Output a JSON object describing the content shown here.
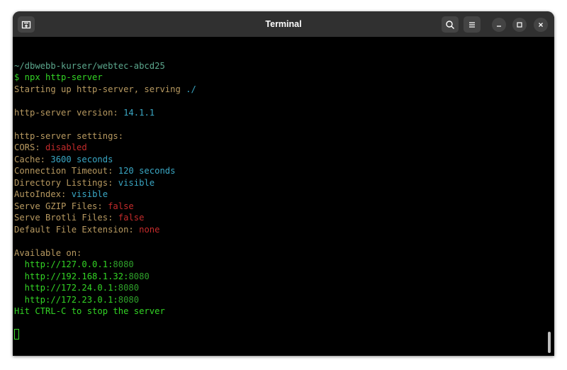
{
  "window": {
    "title": "Terminal"
  },
  "colors": {
    "background": "#000000",
    "titlebar": "#303030",
    "green": "#3bd42a",
    "bright_green": "#30c030",
    "yellowish": "#c0a060",
    "red": "#c42b2b",
    "cyan": "#3aa7c4",
    "dim_path": "#5aa88a"
  },
  "icons": {
    "new_tab": "new-tab-icon",
    "search": "search-icon",
    "menu": "hamburger-menu-icon",
    "minimize": "minimize-icon",
    "maximize": "maximize-icon",
    "close": "close-icon"
  },
  "terminal": {
    "lines": [
      [],
      [
        {
          "t": "~/dbwebb-kurser/webtec-abcd25",
          "c": "#5ca88e"
        }
      ],
      [
        {
          "t": "$ npx http-server",
          "c": "#33d425"
        }
      ],
      [
        {
          "t": "Starting up http-server, serving ",
          "c": "#b79960"
        },
        {
          "t": "./",
          "c": "#3aa7c4"
        }
      ],
      [],
      [
        {
          "t": "http-server version: ",
          "c": "#b79960"
        },
        {
          "t": "14.1.1",
          "c": "#3aa7c4"
        }
      ],
      [],
      [
        {
          "t": "http-server settings:",
          "c": "#b79960"
        }
      ],
      [
        {
          "t": "CORS: ",
          "c": "#b79960"
        },
        {
          "t": "disabled",
          "c": "#c42b2b"
        }
      ],
      [
        {
          "t": "Cache: ",
          "c": "#b79960"
        },
        {
          "t": "3600 seconds",
          "c": "#3aa7c4"
        }
      ],
      [
        {
          "t": "Connection Timeout: ",
          "c": "#b79960"
        },
        {
          "t": "120 seconds",
          "c": "#3aa7c4"
        }
      ],
      [
        {
          "t": "Directory Listings: ",
          "c": "#b79960"
        },
        {
          "t": "visible",
          "c": "#3aa7c4"
        }
      ],
      [
        {
          "t": "AutoIndex: ",
          "c": "#b79960"
        },
        {
          "t": "visible",
          "c": "#3aa7c4"
        }
      ],
      [
        {
          "t": "Serve GZIP Files: ",
          "c": "#b79960"
        },
        {
          "t": "false",
          "c": "#c42b2b"
        }
      ],
      [
        {
          "t": "Serve Brotli Files: ",
          "c": "#b79960"
        },
        {
          "t": "false",
          "c": "#c42b2b"
        }
      ],
      [
        {
          "t": "Default File Extension: ",
          "c": "#b79960"
        },
        {
          "t": "none",
          "c": "#c42b2b"
        }
      ],
      [],
      [
        {
          "t": "Available on:",
          "c": "#b79960"
        }
      ],
      [
        {
          "t": "  http://127.0.0.1:",
          "c": "#33d425"
        },
        {
          "t": "8080",
          "c": "#2ea02a"
        }
      ],
      [
        {
          "t": "  http://192.168.1.32:",
          "c": "#33d425"
        },
        {
          "t": "8080",
          "c": "#2ea02a"
        }
      ],
      [
        {
          "t": "  http://172.24.0.1:",
          "c": "#33d425"
        },
        {
          "t": "8080",
          "c": "#2ea02a"
        }
      ],
      [
        {
          "t": "  http://172.23.0.1:",
          "c": "#33d425"
        },
        {
          "t": "8080",
          "c": "#2ea02a"
        }
      ],
      [
        {
          "t": "Hit CTRL-C to stop the server",
          "c": "#33d425"
        }
      ],
      [],
      [
        {
          "cursor": true
        }
      ]
    ]
  }
}
